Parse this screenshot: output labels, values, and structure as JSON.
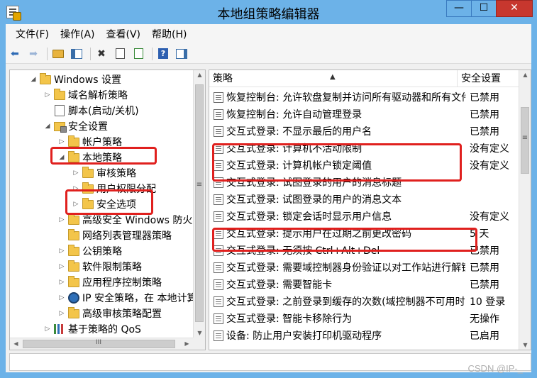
{
  "window": {
    "title": "本地组策略编辑器",
    "minimize_glyph": "—",
    "maximize_glyph": "☐",
    "close_glyph": "✕"
  },
  "menubar": {
    "items": [
      "文件(F)",
      "操作(A)",
      "查看(V)",
      "帮助(H)"
    ]
  },
  "toolbar": {
    "back_glyph": "⬅",
    "forward_glyph": "➡",
    "delete_glyph": "✖",
    "help_glyph": "?"
  },
  "tree": {
    "items": [
      {
        "label": "Windows 设置",
        "arrow": "◢",
        "icon": "folder-icon"
      },
      {
        "label": "域名解析策略",
        "arrow": "▷",
        "icon": "folder-icon"
      },
      {
        "label": "脚本(启动/关机)",
        "arrow": "",
        "icon": "script-icon"
      },
      {
        "label": "安全设置",
        "arrow": "◢",
        "icon": "security-folder-icon"
      },
      {
        "label": "帐户策略",
        "arrow": "▷",
        "icon": "folder-icon"
      },
      {
        "label": "本地策略",
        "arrow": "◢",
        "icon": "folder-icon"
      },
      {
        "label": "审核策略",
        "arrow": "▷",
        "icon": "folder-icon"
      },
      {
        "label": "用户权限分配",
        "arrow": "▷",
        "icon": "folder-icon"
      },
      {
        "label": "安全选项",
        "arrow": "▷",
        "icon": "folder-icon"
      },
      {
        "label": "高级安全 Windows 防火墙",
        "arrow": "▷",
        "icon": "folder-icon"
      },
      {
        "label": "网络列表管理器策略",
        "arrow": "",
        "icon": "folder-icon"
      },
      {
        "label": "公钥策略",
        "arrow": "▷",
        "icon": "folder-icon"
      },
      {
        "label": "软件限制策略",
        "arrow": "▷",
        "icon": "folder-icon"
      },
      {
        "label": "应用程序控制策略",
        "arrow": "▷",
        "icon": "folder-icon"
      },
      {
        "label": "IP 安全策略，在 本地计算机",
        "arrow": "▷",
        "icon": "ip-security-icon"
      },
      {
        "label": "高级审核策略配置",
        "arrow": "▷",
        "icon": "folder-icon"
      },
      {
        "label": "基于策略的 QoS",
        "arrow": "▷",
        "icon": "qos-chart-icon"
      }
    ]
  },
  "list": {
    "columns": {
      "policy": "策略",
      "setting": "安全设置"
    },
    "rows": [
      {
        "policy": "恢复控制台: 允许软盘复制并访问所有驱动器和所有文件夹",
        "setting": "已禁用"
      },
      {
        "policy": "恢复控制台: 允许自动管理登录",
        "setting": "已禁用"
      },
      {
        "policy": "交互式登录: 不显示最后的用户名",
        "setting": "已禁用"
      },
      {
        "policy": "交互式登录: 计算机不活动限制",
        "setting": "没有定义"
      },
      {
        "policy": "交互式登录: 计算机帐户锁定阈值",
        "setting": "没有定义"
      },
      {
        "policy": "交互式登录: 试图登录的用户的消息标题",
        "setting": ""
      },
      {
        "policy": "交互式登录: 试图登录的用户的消息文本",
        "setting": ""
      },
      {
        "policy": "交互式登录: 锁定会话时显示用户信息",
        "setting": "没有定义"
      },
      {
        "policy": "交互式登录: 提示用户在过期之前更改密码",
        "setting": "5 天"
      },
      {
        "policy": "交互式登录: 无须按 Ctrl+Alt+Del",
        "setting": "已禁用"
      },
      {
        "policy": "交互式登录: 需要域控制器身份验证以对工作站进行解锁",
        "setting": "已禁用"
      },
      {
        "policy": "交互式登录: 需要智能卡",
        "setting": "已禁用"
      },
      {
        "policy": "交互式登录: 之前登录到缓存的次数(域控制器不可用时)",
        "setting": "10 登录"
      },
      {
        "policy": "交互式登录: 智能卡移除行为",
        "setting": "无操作"
      },
      {
        "policy": "设备: 防止用户安装打印机驱动程序",
        "setting": "已启用"
      }
    ]
  },
  "scrollbar": {
    "up_glyph": "▲",
    "down_glyph": "▼",
    "left_glyph": "◀",
    "right_glyph": "▶",
    "grip_glyph": "≡",
    "hgrip_glyph": "III"
  },
  "watermark": "CSDN @IP-_"
}
